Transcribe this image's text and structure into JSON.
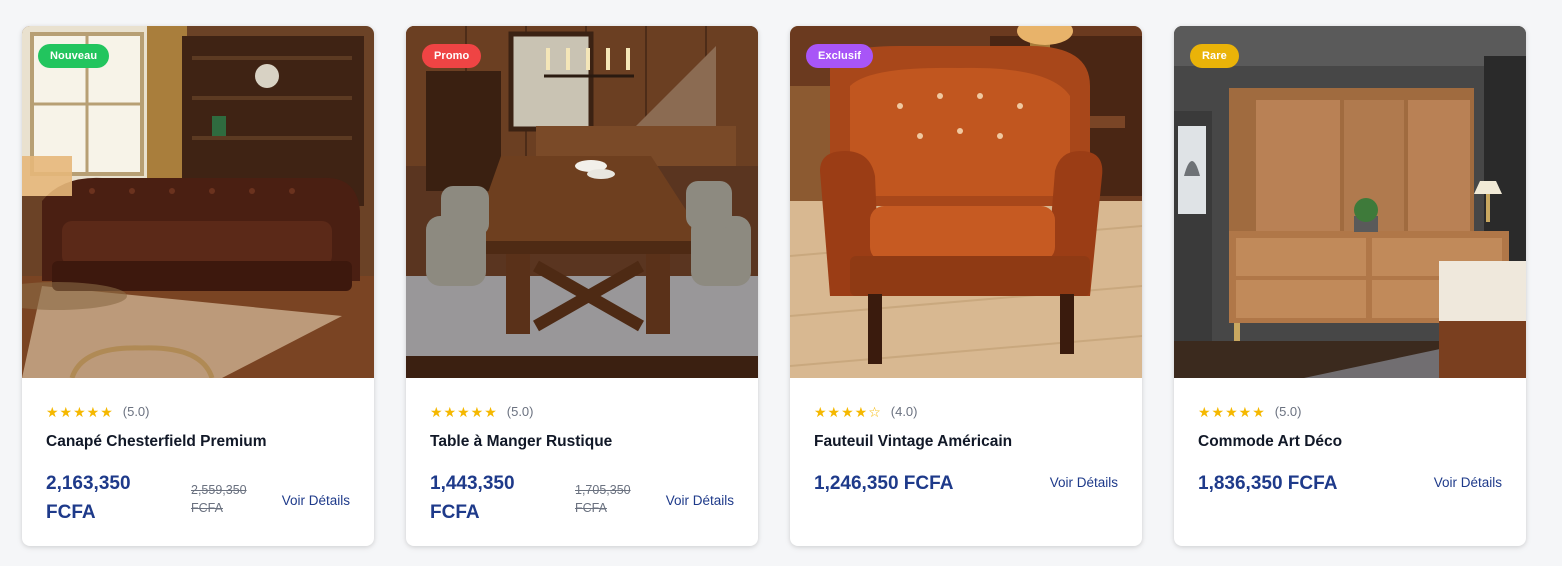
{
  "products": [
    {
      "badge": "Nouveau",
      "badge_color": "#22c55e",
      "stars": "★★★★★",
      "stars_empty": "",
      "rating": "(5.0)",
      "name": "Canapé Chesterfield Premium",
      "price": "2,163,350 FCFA",
      "old_price": "2,559,350 FCFA",
      "link": "Voir Détails"
    },
    {
      "badge": "Promo",
      "badge_color": "#ef4444",
      "stars": "★★★★★",
      "stars_empty": "",
      "rating": "(5.0)",
      "name": "Table à Manger Rustique",
      "price": "1,443,350 FCFA",
      "old_price": "1,705,350 FCFA",
      "link": "Voir Détails"
    },
    {
      "badge": "Exclusif",
      "badge_color": "#a855f7",
      "stars": "★★★★",
      "stars_empty": "☆",
      "rating": "(4.0)",
      "name": "Fauteuil Vintage Américain",
      "price": "1,246,350 FCFA",
      "link": "Voir Détails"
    },
    {
      "badge": "Rare",
      "badge_color": "#eab308",
      "stars": "★★★★★",
      "stars_empty": "",
      "rating": "(5.0)",
      "name": "Commode Art Déco",
      "price": "1,836,350 FCFA",
      "link": "Voir Détails"
    }
  ],
  "theme": {
    "price_color": "#1e3a8a",
    "star_color": "#f5b800"
  }
}
